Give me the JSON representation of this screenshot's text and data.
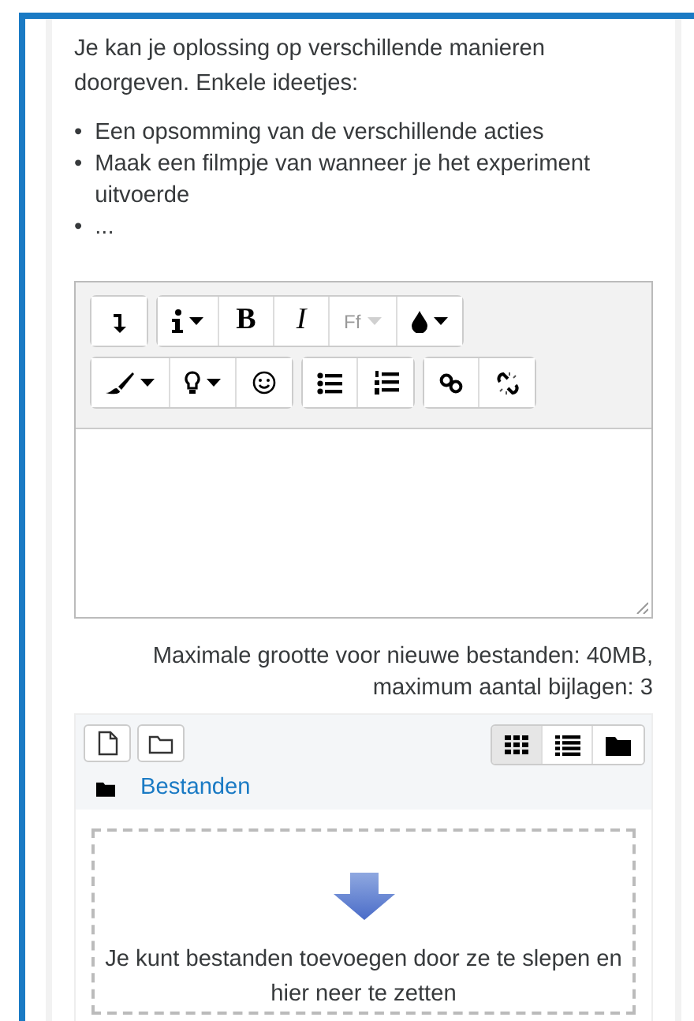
{
  "intro": "Je kan je oplossing op verschillende manieren doorgeven. Enkele ideetjes:",
  "ideas": [
    {
      "marker": "•",
      "text": "Een opsomming van de verschillende acties"
    },
    {
      "marker": "•",
      "text": "Maak een filmpje van wanneer je het experiment uitvoerde"
    },
    {
      "marker": "•",
      "text": "..."
    }
  ],
  "editor": {
    "toolbar_rows": [
      [
        [
          {
            "kind": "icon",
            "dropdown": false,
            "disabled": false
          }
        ],
        [
          {
            "kind": "icon",
            "dropdown": true,
            "disabled": false
          },
          {
            "kind": "text",
            "label": "B",
            "dropdown": false,
            "disabled": false
          },
          {
            "kind": "text",
            "label": "I",
            "dropdown": false,
            "disabled": false
          },
          {
            "kind": "text",
            "label": "Ff",
            "dropdown": true,
            "disabled": true
          },
          {
            "kind": "icon",
            "dropdown": true,
            "disabled": false
          }
        ]
      ],
      [
        [
          {
            "kind": "icon",
            "dropdown": true,
            "disabled": false
          },
          {
            "kind": "icon",
            "dropdown": true,
            "disabled": false
          },
          {
            "kind": "icon",
            "dropdown": false,
            "disabled": false
          }
        ],
        [
          {
            "kind": "icon",
            "dropdown": false,
            "disabled": false
          },
          {
            "kind": "icon",
            "dropdown": false,
            "disabled": false
          }
        ],
        [
          {
            "kind": "icon",
            "dropdown": false,
            "disabled": false
          },
          {
            "kind": "icon",
            "dropdown": false,
            "disabled": false
          }
        ]
      ]
    ]
  },
  "limits": [
    "Maximale grootte voor nieuwe bestanden: 40MB,",
    "maximum aantal bijlagen: 3"
  ],
  "filemanager": {
    "views": [
      {
        "selected": true
      },
      {
        "selected": false
      },
      {
        "selected": false
      }
    ],
    "path": "Bestanden",
    "drop_hint": "Je kunt bestanden toevoegen door ze te slepen en hier neer te zetten"
  }
}
